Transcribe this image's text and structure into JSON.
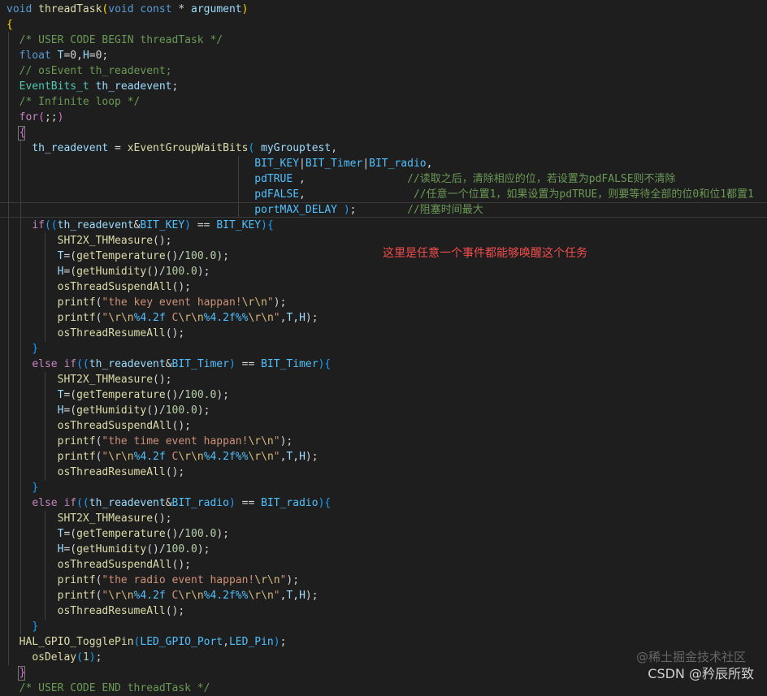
{
  "editor": {
    "lines": [
      [
        [
          "kw",
          "void "
        ],
        [
          "fn",
          "threadTask"
        ],
        [
          "br1",
          "("
        ],
        [
          "kw",
          "void const"
        ],
        [
          "pl",
          " * "
        ],
        [
          "var",
          "argument"
        ],
        [
          "br1",
          ")"
        ]
      ],
      [
        [
          "br1",
          "{"
        ]
      ],
      [
        [
          "pl",
          "  "
        ],
        [
          "cm",
          "/* USER CODE BEGIN threadTask */"
        ]
      ],
      [
        [
          "pl",
          "  "
        ],
        [
          "kw",
          "float "
        ],
        [
          "var",
          "T"
        ],
        [
          "pl",
          "=0,"
        ],
        [
          "var",
          "H"
        ],
        [
          "pl",
          "=0;"
        ]
      ],
      [
        [
          "pl",
          "  "
        ],
        [
          "cm",
          "// osEvent th_readevent;"
        ]
      ],
      [
        [
          "pl",
          "  "
        ],
        [
          "ty",
          "EventBits_t "
        ],
        [
          "var",
          "th_readevent"
        ],
        [
          "pl",
          ";"
        ]
      ],
      [
        [
          "pl",
          "  "
        ],
        [
          "cm",
          "/* Infinite loop */"
        ]
      ],
      [
        [
          "pl",
          "  "
        ],
        [
          "ctrl",
          "for"
        ],
        [
          "br2",
          "("
        ],
        [
          "pl",
          ";;"
        ],
        [
          "br2",
          ")"
        ]
      ],
      [
        [
          "pl",
          "  "
        ],
        [
          "br2",
          "{"
        ]
      ],
      [
        [
          "pl",
          "    "
        ],
        [
          "var",
          "th_readevent"
        ],
        [
          "pl",
          " = "
        ],
        [
          "fn",
          "xEventGroupWaitBits"
        ],
        [
          "br3",
          "("
        ],
        [
          "pl",
          " "
        ],
        [
          "var",
          "myGrouptest"
        ],
        [
          "pl",
          ","
        ]
      ],
      [
        [
          "pl",
          "                                       "
        ],
        [
          "mac",
          "BIT_KEY"
        ],
        [
          "pl",
          "|"
        ],
        [
          "mac",
          "BIT_Timer"
        ],
        [
          "pl",
          "|"
        ],
        [
          "mac",
          "BIT_radio"
        ],
        [
          "pl",
          ","
        ]
      ],
      [
        [
          "pl",
          "                                       "
        ],
        [
          "mac",
          "pdTRUE"
        ],
        [
          "pl",
          " ,                "
        ],
        [
          "cm",
          "//读取之后，清除相应的位，若设置为pdFALSE则不清除"
        ]
      ],
      [
        [
          "pl",
          "                                       "
        ],
        [
          "mac",
          "pdFALSE"
        ],
        [
          "pl",
          ",                 "
        ],
        [
          "cm",
          "//任意一个位置1，如果设置为pdTRUE，则要等待全部的位0和位1都置1"
        ]
      ],
      [
        [
          "pl",
          "                                       "
        ],
        [
          "mac",
          "portMAX_DELAY"
        ],
        [
          "pl",
          " "
        ],
        [
          "br3",
          ")"
        ],
        [
          "pl",
          ";        "
        ],
        [
          "cm",
          "//阻塞时间最大"
        ]
      ],
      [
        [
          "pl",
          "    "
        ],
        [
          "ctrl",
          "if"
        ],
        [
          "br3",
          "(("
        ],
        [
          "var",
          "th_readevent"
        ],
        [
          "pl",
          "&"
        ],
        [
          "mac",
          "BIT_KEY"
        ],
        [
          "br3",
          ")"
        ],
        [
          "pl",
          " == "
        ],
        [
          "mac",
          "BIT_KEY"
        ],
        [
          "br3",
          ")"
        ],
        [
          "br3",
          "{"
        ]
      ],
      [
        [
          "pl",
          "        "
        ],
        [
          "fn",
          "SHT2X_THMeasure"
        ],
        [
          "pl",
          "();"
        ]
      ],
      [
        [
          "pl",
          "        "
        ],
        [
          "var",
          "T"
        ],
        [
          "pl",
          "=("
        ],
        [
          "fn",
          "getTemperature"
        ],
        [
          "pl",
          "()/"
        ],
        [
          "num",
          "100.0"
        ],
        [
          "pl",
          ");"
        ]
      ],
      [
        [
          "pl",
          "        "
        ],
        [
          "var",
          "H"
        ],
        [
          "pl",
          "=("
        ],
        [
          "fn",
          "getHumidity"
        ],
        [
          "pl",
          "()/"
        ],
        [
          "num",
          "100.0"
        ],
        [
          "pl",
          ");"
        ]
      ],
      [
        [
          "pl",
          "        "
        ],
        [
          "fn",
          "osThreadSuspendAll"
        ],
        [
          "pl",
          "();"
        ]
      ],
      [
        [
          "pl",
          "        "
        ],
        [
          "fn",
          "printf"
        ],
        [
          "pl",
          "("
        ],
        [
          "str",
          "\"the key event happan!"
        ],
        [
          "esc",
          "\\r\\n"
        ],
        [
          "str",
          "\""
        ],
        [
          "pl",
          ");"
        ]
      ],
      [
        [
          "pl",
          "        "
        ],
        [
          "fn",
          "printf"
        ],
        [
          "pl",
          "("
        ],
        [
          "str",
          "\""
        ],
        [
          "esc",
          "\\r\\n"
        ],
        [
          "mac",
          "%4.2f"
        ],
        [
          "str",
          " C"
        ],
        [
          "esc",
          "\\r\\n"
        ],
        [
          "mac",
          "%4.2f%%"
        ],
        [
          "esc",
          "\\r\\n"
        ],
        [
          "str",
          "\""
        ],
        [
          "pl",
          ","
        ],
        [
          "var",
          "T"
        ],
        [
          "pl",
          ","
        ],
        [
          "var",
          "H"
        ],
        [
          "pl",
          ");"
        ]
      ],
      [
        [
          "pl",
          "        "
        ],
        [
          "fn",
          "osThreadResumeAll"
        ],
        [
          "pl",
          "();"
        ]
      ],
      [
        [
          "pl",
          "    "
        ],
        [
          "br3",
          "}"
        ]
      ],
      [
        [
          "pl",
          "    "
        ],
        [
          "ctrl",
          "else if"
        ],
        [
          "br3",
          "(("
        ],
        [
          "var",
          "th_readevent"
        ],
        [
          "pl",
          "&"
        ],
        [
          "mac",
          "BIT_Timer"
        ],
        [
          "br3",
          ")"
        ],
        [
          "pl",
          " == "
        ],
        [
          "mac",
          "BIT_Timer"
        ],
        [
          "br3",
          ")"
        ],
        [
          "br3",
          "{"
        ]
      ],
      [
        [
          "pl",
          "        "
        ],
        [
          "fn",
          "SHT2X_THMeasure"
        ],
        [
          "pl",
          "();"
        ]
      ],
      [
        [
          "pl",
          "        "
        ],
        [
          "var",
          "T"
        ],
        [
          "pl",
          "=("
        ],
        [
          "fn",
          "getTemperature"
        ],
        [
          "pl",
          "()/"
        ],
        [
          "num",
          "100.0"
        ],
        [
          "pl",
          ");"
        ]
      ],
      [
        [
          "pl",
          "        "
        ],
        [
          "var",
          "H"
        ],
        [
          "pl",
          "=("
        ],
        [
          "fn",
          "getHumidity"
        ],
        [
          "pl",
          "()/"
        ],
        [
          "num",
          "100.0"
        ],
        [
          "pl",
          ");"
        ]
      ],
      [
        [
          "pl",
          "        "
        ],
        [
          "fn",
          "osThreadSuspendAll"
        ],
        [
          "pl",
          "();"
        ]
      ],
      [
        [
          "pl",
          "        "
        ],
        [
          "fn",
          "printf"
        ],
        [
          "pl",
          "("
        ],
        [
          "str",
          "\"the time event happan!"
        ],
        [
          "esc",
          "\\r\\n"
        ],
        [
          "str",
          "\""
        ],
        [
          "pl",
          ");"
        ]
      ],
      [
        [
          "pl",
          "        "
        ],
        [
          "fn",
          "printf"
        ],
        [
          "pl",
          "("
        ],
        [
          "str",
          "\""
        ],
        [
          "esc",
          "\\r\\n"
        ],
        [
          "mac",
          "%4.2f"
        ],
        [
          "str",
          " C"
        ],
        [
          "esc",
          "\\r\\n"
        ],
        [
          "mac",
          "%4.2f%%"
        ],
        [
          "esc",
          "\\r\\n"
        ],
        [
          "str",
          "\""
        ],
        [
          "pl",
          ","
        ],
        [
          "var",
          "T"
        ],
        [
          "pl",
          ","
        ],
        [
          "var",
          "H"
        ],
        [
          "pl",
          ");"
        ]
      ],
      [
        [
          "pl",
          "        "
        ],
        [
          "fn",
          "osThreadResumeAll"
        ],
        [
          "pl",
          "();"
        ]
      ],
      [
        [
          "pl",
          "    "
        ],
        [
          "br3",
          "}"
        ]
      ],
      [
        [
          "pl",
          "    "
        ],
        [
          "ctrl",
          "else if"
        ],
        [
          "br3",
          "(("
        ],
        [
          "var",
          "th_readevent"
        ],
        [
          "pl",
          "&"
        ],
        [
          "mac",
          "BIT_radio"
        ],
        [
          "br3",
          ")"
        ],
        [
          "pl",
          " == "
        ],
        [
          "mac",
          "BIT_radio"
        ],
        [
          "br3",
          ")"
        ],
        [
          "br3",
          "{"
        ]
      ],
      [
        [
          "pl",
          "        "
        ],
        [
          "fn",
          "SHT2X_THMeasure"
        ],
        [
          "pl",
          "();"
        ]
      ],
      [
        [
          "pl",
          "        "
        ],
        [
          "var",
          "T"
        ],
        [
          "pl",
          "=("
        ],
        [
          "fn",
          "getTemperature"
        ],
        [
          "pl",
          "()/"
        ],
        [
          "num",
          "100.0"
        ],
        [
          "pl",
          ");"
        ]
      ],
      [
        [
          "pl",
          "        "
        ],
        [
          "var",
          "H"
        ],
        [
          "pl",
          "=("
        ],
        [
          "fn",
          "getHumidity"
        ],
        [
          "pl",
          "()/"
        ],
        [
          "num",
          "100.0"
        ],
        [
          "pl",
          ");"
        ]
      ],
      [
        [
          "pl",
          "        "
        ],
        [
          "fn",
          "osThreadSuspendAll"
        ],
        [
          "pl",
          "();"
        ]
      ],
      [
        [
          "pl",
          "        "
        ],
        [
          "fn",
          "printf"
        ],
        [
          "pl",
          "("
        ],
        [
          "str",
          "\"the radio event happan!"
        ],
        [
          "esc",
          "\\r\\n"
        ],
        [
          "str",
          "\""
        ],
        [
          "pl",
          ");"
        ]
      ],
      [
        [
          "pl",
          "        "
        ],
        [
          "fn",
          "printf"
        ],
        [
          "pl",
          "("
        ],
        [
          "str",
          "\""
        ],
        [
          "esc",
          "\\r\\n"
        ],
        [
          "mac",
          "%4.2f"
        ],
        [
          "str",
          " C"
        ],
        [
          "esc",
          "\\r\\n"
        ],
        [
          "mac",
          "%4.2f%%"
        ],
        [
          "esc",
          "\\r\\n"
        ],
        [
          "str",
          "\""
        ],
        [
          "pl",
          ","
        ],
        [
          "var",
          "T"
        ],
        [
          "pl",
          ","
        ],
        [
          "var",
          "H"
        ],
        [
          "pl",
          ");"
        ]
      ],
      [
        [
          "pl",
          "        "
        ],
        [
          "fn",
          "osThreadResumeAll"
        ],
        [
          "pl",
          "();"
        ]
      ],
      [
        [
          "pl",
          "    "
        ],
        [
          "br3",
          "}"
        ]
      ],
      [
        [
          "pl",
          "  "
        ],
        [
          "fn",
          "HAL_GPIO_TogglePin"
        ],
        [
          "br3",
          "("
        ],
        [
          "mac",
          "LED_GPIO_Port"
        ],
        [
          "pl",
          ","
        ],
        [
          "mac",
          "LED_Pin"
        ],
        [
          "br3",
          ")"
        ],
        [
          "pl",
          ";"
        ]
      ],
      [
        [
          "pl",
          "    "
        ],
        [
          "fn",
          "osDelay"
        ],
        [
          "br3",
          "("
        ],
        [
          "num",
          "1"
        ],
        [
          "br3",
          ")"
        ],
        [
          "pl",
          ";"
        ]
      ],
      [
        [
          "pl",
          "  "
        ],
        [
          "br2",
          "}"
        ]
      ],
      [
        [
          "pl",
          "  "
        ],
        [
          "cm",
          "/* USER CODE END threadTask */"
        ]
      ]
    ]
  },
  "annotation": {
    "text": "这里是任意一个事件都能够唤醒这个任务",
    "color": "#f14c4c"
  },
  "watermark": {
    "line1": "@稀土掘金技术社区",
    "line2": "CSDN @矜辰所致"
  }
}
